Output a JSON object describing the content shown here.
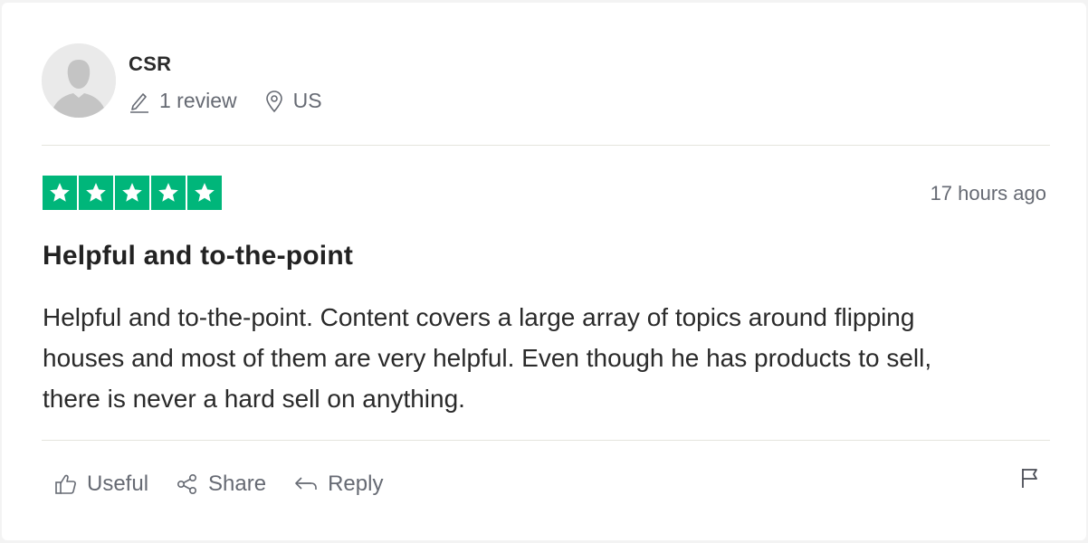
{
  "reviewer": {
    "name": "CSR",
    "review_count": "1 review",
    "location": "US"
  },
  "review": {
    "rating": 5,
    "rating_max": 5,
    "star_color": "#00b67a",
    "date": "17 hours ago",
    "title": "Helpful and to-the-point",
    "body": "Helpful and to-the-point. Content covers a large array of topics around flipping houses and most of them are very helpful. Even though he has products to sell, there is never a hard sell on anything."
  },
  "actions": {
    "useful_label": "Useful",
    "share_label": "Share",
    "reply_label": "Reply"
  },
  "icons": {
    "avatar": "default-user-avatar",
    "review_count": "pencil-icon",
    "location": "map-pin-icon",
    "star": "star-icon",
    "useful": "thumbs-up-icon",
    "share": "share-icon",
    "reply": "reply-arrow-icon",
    "flag": "flag-icon"
  }
}
